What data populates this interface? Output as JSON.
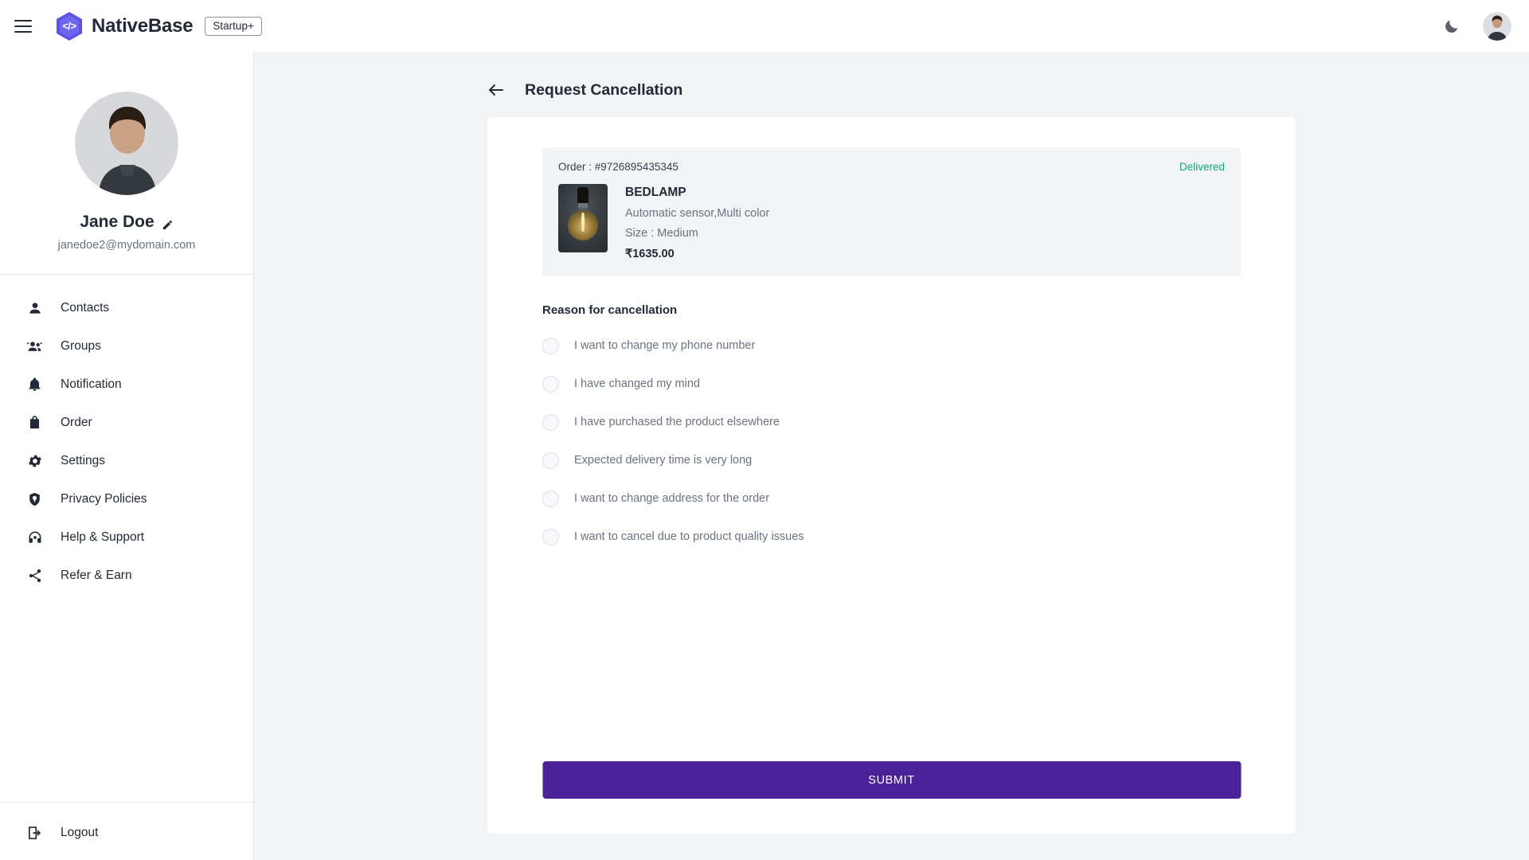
{
  "topbar": {
    "menu_icon": "hamburger-menu-icon",
    "logo_icon": "nativebase-hexagon-logo",
    "logo_glyph": "</>",
    "brand_name": "NativeBase",
    "plan_badge": "Startup+",
    "theme_toggle_icon": "moon-icon",
    "avatar_icon": "user-avatar"
  },
  "sidebar": {
    "profile": {
      "avatar_icon": "profile-photo",
      "name": "Jane Doe",
      "edit_icon": "pencil-edit-icon",
      "email": "janedoe2@mydomain.com"
    },
    "items": [
      {
        "label": "Contacts",
        "icon": "person-icon"
      },
      {
        "label": "Groups",
        "icon": "people-group-icon"
      },
      {
        "label": "Notification",
        "icon": "bell-icon"
      },
      {
        "label": "Order",
        "icon": "shopping-bag-icon"
      },
      {
        "label": "Settings",
        "icon": "gear-icon"
      },
      {
        "label": "Privacy Policies",
        "icon": "shield-icon"
      },
      {
        "label": "Help & Support",
        "icon": "headset-support-icon"
      },
      {
        "label": "Refer & Earn",
        "icon": "share-icon"
      }
    ],
    "logout": {
      "label": "Logout",
      "icon": "logout-icon"
    }
  },
  "page": {
    "back_icon": "arrow-left-icon",
    "title": "Request Cancellation"
  },
  "order": {
    "order_number": "Order : #9726895435345",
    "status": "Delivered",
    "status_color": "#18a57a",
    "product": {
      "image_icon": "bedlamp-product-image",
      "name": "BEDLAMP",
      "description": "Automatic sensor,Multi color",
      "size": "Size : Medium",
      "price": "₹1635.00"
    }
  },
  "cancellation": {
    "section_title": "Reason for cancellation",
    "selected": null,
    "options": [
      {
        "label": "I want to change my phone number"
      },
      {
        "label": "I have changed my mind"
      },
      {
        "label": "I have purchased the product elsewhere"
      },
      {
        "label": "Expected delivery time is very long"
      },
      {
        "label": "I want to change address for the order"
      },
      {
        "label": "I want to cancel due to product quality issues"
      }
    ]
  },
  "actions": {
    "submit_label": "SUBMIT",
    "submit_color": "#4a2196"
  }
}
